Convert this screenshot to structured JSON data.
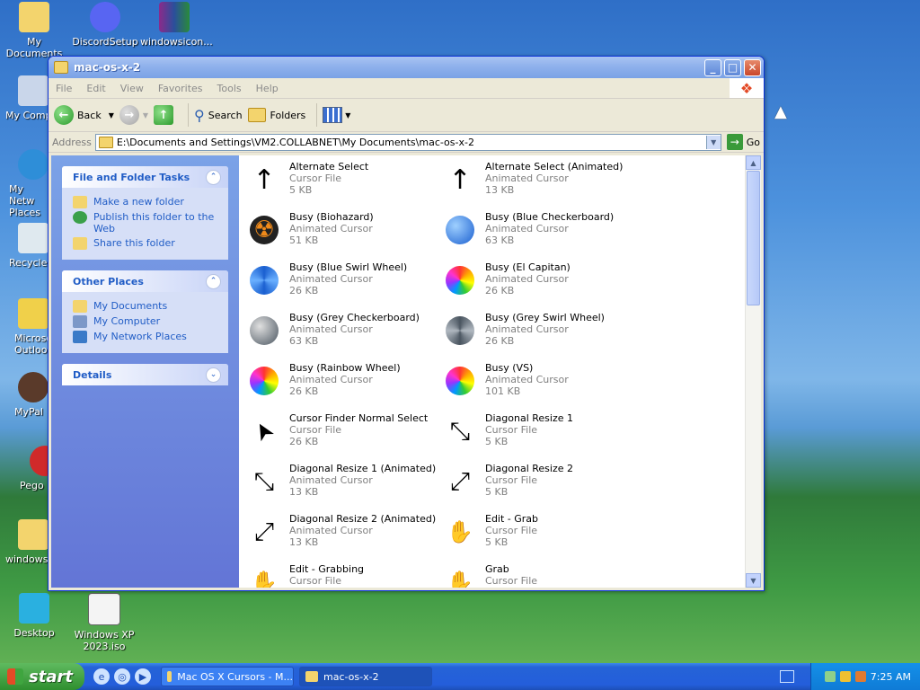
{
  "desktop": {
    "icons": [
      {
        "label": "My Documents"
      },
      {
        "label": "DiscordSetup"
      },
      {
        "label": "windowsicon..."
      },
      {
        "label": "My Comp"
      },
      {
        "label": "My Netw Places"
      },
      {
        "label": "Recycle"
      },
      {
        "label": "Microso Outloo"
      },
      {
        "label": "MyPal"
      },
      {
        "label": "Pego"
      },
      {
        "label": "windows2"
      },
      {
        "label": "Desktop"
      },
      {
        "label": "Windows XP 2023.iso"
      }
    ]
  },
  "window": {
    "title": "mac-os-x-2",
    "menu": [
      "File",
      "Edit",
      "View",
      "Favorites",
      "Tools",
      "Help"
    ],
    "toolbar": {
      "back": "Back",
      "search": "Search",
      "folders": "Folders"
    },
    "address": {
      "label": "Address",
      "value": "E:\\Documents and Settings\\VM2.COLLABNET\\My Documents\\mac-os-x-2",
      "go": "Go"
    }
  },
  "leftpane": {
    "file_tasks": {
      "title": "File and Folder Tasks",
      "items": [
        "Make a new folder",
        "Publish this folder to the Web",
        "Share this folder"
      ]
    },
    "other_places": {
      "title": "Other Places",
      "items": [
        "My Documents",
        "My Computer",
        "My Network Places"
      ]
    },
    "details": {
      "title": "Details"
    }
  },
  "files": [
    {
      "name": "Alternate Select",
      "type": "Cursor File",
      "size": "5 KB",
      "icon": "arrow-up-icon"
    },
    {
      "name": "Alternate Select (Animated)",
      "type": "Animated Cursor",
      "size": "13 KB",
      "icon": "arrow-up-icon"
    },
    {
      "name": "Busy (Biohazard)",
      "type": "Animated Cursor",
      "size": "51 KB",
      "icon": "biohazard-icon"
    },
    {
      "name": "Busy (Blue Checkerboard)",
      "type": "Animated Cursor",
      "size": "63 KB",
      "icon": "blue-ball-icon"
    },
    {
      "name": "Busy (Blue Swirl Wheel)",
      "type": "Animated Cursor",
      "size": "26 KB",
      "icon": "blue-swirl-icon"
    },
    {
      "name": "Busy (El Capitan)",
      "type": "Animated Cursor",
      "size": "26 KB",
      "icon": "rainbow-wheel-icon"
    },
    {
      "name": "Busy (Grey Checkerboard)",
      "type": "Animated Cursor",
      "size": "63 KB",
      "icon": "grey-ball-icon"
    },
    {
      "name": "Busy (Grey Swirl Wheel)",
      "type": "Animated Cursor",
      "size": "26 KB",
      "icon": "grey-swirl-icon"
    },
    {
      "name": "Busy (Rainbow Wheel)",
      "type": "Animated Cursor",
      "size": "26 KB",
      "icon": "rainbow-wheel-icon"
    },
    {
      "name": "Busy (VS)",
      "type": "Animated Cursor",
      "size": "101 KB",
      "icon": "rainbow-wheel-icon"
    },
    {
      "name": "Cursor Finder Normal Select",
      "type": "Cursor File",
      "size": "26 KB",
      "icon": "pointer-icon"
    },
    {
      "name": "Diagonal Resize 1",
      "type": "Cursor File",
      "size": "5 KB",
      "icon": "diag-resize-1-icon"
    },
    {
      "name": "Diagonal Resize 1 (Animated)",
      "type": "Animated Cursor",
      "size": "13 KB",
      "icon": "diag-resize-1-icon"
    },
    {
      "name": "Diagonal Resize 2",
      "type": "Cursor File",
      "size": "5 KB",
      "icon": "diag-resize-2-icon"
    },
    {
      "name": "Diagonal Resize 2 (Animated)",
      "type": "Animated Cursor",
      "size": "13 KB",
      "icon": "diag-resize-2-icon"
    },
    {
      "name": "Edit - Grab",
      "type": "Cursor File",
      "size": "5 KB",
      "icon": "hand-icon"
    },
    {
      "name": "Edit - Grabbing",
      "type": "Cursor File",
      "size": "",
      "icon": "hand-icon"
    },
    {
      "name": "Grab",
      "type": "Cursor File",
      "size": "",
      "icon": "hand-icon"
    }
  ],
  "taskbar": {
    "start": "start",
    "items": [
      "Mac OS X Cursors - M...",
      "mac-os-x-2"
    ],
    "clock": "7:25 AM"
  }
}
